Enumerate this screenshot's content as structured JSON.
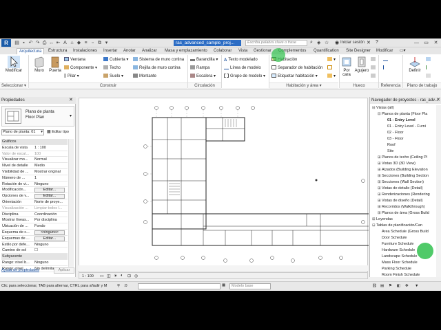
{
  "app": {
    "logo": "R",
    "doc_title": "rac_advanced_sample_proj...",
    "search_placeholder": "Escriba palabra clave o frase",
    "signin": "Iniciar sesión"
  },
  "tabs": [
    "Arquitectura",
    "Estructura",
    "Instalaciones",
    "Insertar",
    "Anotar",
    "Analizar",
    "Masa y emplazamiento",
    "Colaborar",
    "Vista",
    "Gestionar",
    "Complementos",
    "Quantification",
    "Site Designer",
    "Modificar"
  ],
  "active_tab": "Arquitectura",
  "ribbon": {
    "modify": "Modificar",
    "wall": "Muro",
    "door": "Puerta",
    "window": "Ventana",
    "component": "Componente",
    "column": "Pilar",
    "roof": "Cubierta",
    "ceiling": "Techo",
    "floor": "Suelo",
    "curtain_system": "Sistema de muro cortina",
    "curtain_grid": "Rejilla de muro cortina",
    "mullion": "Montante",
    "railing": "Barandilla",
    "ramp": "Rampa",
    "stair": "Escalera",
    "model_text": "Texto modelado",
    "model_line": "Línea de modelo",
    "model_group": "Grupo de modelo",
    "room": "Habitación",
    "room_separator": "Separador de habitación",
    "tag_room": "Etiquetar habitación",
    "by_face": "Por cara",
    "shaft": "Agujero",
    "set": "Definir",
    "panels": {
      "select": "Seleccionar",
      "build": "Construir",
      "circulation": "Circulación",
      "room_area": "Habitación y área",
      "opening": "Hueco",
      "datum": "Referencia",
      "workplane": "Plano de trabajo"
    }
  },
  "properties": {
    "title": "Propiedades",
    "type_line1": "Plano de planta",
    "type_line2": "Floor Plan",
    "view_select": "Plano de planta: 01",
    "edit_type": "Editar tipo",
    "rows": [
      {
        "k": "Gráficos",
        "v": "",
        "sec": true
      },
      {
        "k": "Escala de vista",
        "v": "1 : 100"
      },
      {
        "k": "Valor de escal...",
        "v": "100",
        "grey": true
      },
      {
        "k": "Visualizar mo...",
        "v": "Normal"
      },
      {
        "k": "Nivel de detalle",
        "v": "Medio"
      },
      {
        "k": "Visibilidad de ...",
        "v": "Mostrar original"
      },
      {
        "k": "Número de ...",
        "v": "1"
      },
      {
        "k": "Rotación de vi...",
        "v": "Ninguno"
      },
      {
        "k": "Modificación...",
        "v": "Editar...",
        "btn": true
      },
      {
        "k": "Opciones de v...",
        "v": "Editar...",
        "btn": true
      },
      {
        "k": "Orientación",
        "v": "Norte de proye..."
      },
      {
        "k": "Visualización ...",
        "v": "Limpiar todos l...",
        "grey": true
      },
      {
        "k": "Disciplina",
        "v": "Coordinación"
      },
      {
        "k": "Mostrar líneas...",
        "v": "Por disciplina"
      },
      {
        "k": "Ubicación de ...",
        "v": "Fondo"
      },
      {
        "k": "Esquema de c...",
        "v": "<ninguno>",
        "btn": true
      },
      {
        "k": "Esquemas de ...",
        "v": "Editar...",
        "btn": true
      },
      {
        "k": "Estilo por defe...",
        "v": "Ninguno"
      },
      {
        "k": "Camino de sol",
        "v": "☐"
      },
      {
        "k": "Subyacente",
        "v": "",
        "sec": true
      },
      {
        "k": "Rango: nivel b...",
        "v": "Ninguno"
      },
      {
        "k": "Rango: nivel ...",
        "v": "Sin delimitar"
      }
    ],
    "help": "Ayuda de propiedades",
    "apply": "Aplicar"
  },
  "browser": {
    "title": "Navegador de proyectos - rac_adv...",
    "items": [
      {
        "t": "Vistas (all)",
        "lvl": 0,
        "tw": "⊟"
      },
      {
        "t": "Planos de planta (Floor Pla",
        "lvl": 1,
        "tw": "⊟"
      },
      {
        "t": "01 - Entry Level",
        "lvl": 2,
        "tw": "",
        "sel": true
      },
      {
        "t": "01 - Entry Level - Furni",
        "lvl": 2,
        "tw": ""
      },
      {
        "t": "02 - Floor",
        "lvl": 2,
        "tw": ""
      },
      {
        "t": "03 - Floor",
        "lvl": 2,
        "tw": ""
      },
      {
        "t": "Roof",
        "lvl": 2,
        "tw": ""
      },
      {
        "t": "Site",
        "lvl": 2,
        "tw": ""
      },
      {
        "t": "Planos de techo (Ceiling Pl",
        "lvl": 1,
        "tw": "⊞"
      },
      {
        "t": "Vistas 3D (3D View)",
        "lvl": 1,
        "tw": "⊞"
      },
      {
        "t": "Alzados (Building Elevation",
        "lvl": 1,
        "tw": "⊞"
      },
      {
        "t": "Secciones (Building Section",
        "lvl": 1,
        "tw": "⊞"
      },
      {
        "t": "Secciones (Wall Section)",
        "lvl": 1,
        "tw": "⊞"
      },
      {
        "t": "Vistas de detalle (Detail)",
        "lvl": 1,
        "tw": "⊞"
      },
      {
        "t": "Renderizaciones (Rendering",
        "lvl": 1,
        "tw": "⊞"
      },
      {
        "t": "Vistas de diseño (Detail)",
        "lvl": 1,
        "tw": "⊞"
      },
      {
        "t": "Recorridos (Walkthrough)",
        "lvl": 1,
        "tw": "⊞"
      },
      {
        "t": "Planos de área (Gross Build",
        "lvl": 1,
        "tw": "⊞"
      },
      {
        "t": "Leyendas",
        "lvl": 0,
        "tw": "⊞"
      },
      {
        "t": "Tablas de planificación/Can",
        "lvl": 0,
        "tw": "⊟"
      },
      {
        "t": "Area Schedule (Gross Build",
        "lvl": 1,
        "tw": ""
      },
      {
        "t": "Door Schedule",
        "lvl": 1,
        "tw": ""
      },
      {
        "t": "Furniture Schedule",
        "lvl": 1,
        "tw": ""
      },
      {
        "t": "Hardware Schedule",
        "lvl": 1,
        "tw": ""
      },
      {
        "t": "Landscape Schedule",
        "lvl": 1,
        "tw": ""
      },
      {
        "t": "Mass Floor Schedule",
        "lvl": 1,
        "tw": ""
      },
      {
        "t": "Parking Schedule",
        "lvl": 1,
        "tw": ""
      },
      {
        "t": "Room Finish Schedule",
        "lvl": 1,
        "tw": ""
      }
    ]
  },
  "view_bar": {
    "scale": "1 : 100"
  },
  "status": {
    "text": "Clic para seleccionar, TAB para alternar, CTRL para añadir y M",
    "zero": ":0",
    "model": "Modelo base"
  }
}
